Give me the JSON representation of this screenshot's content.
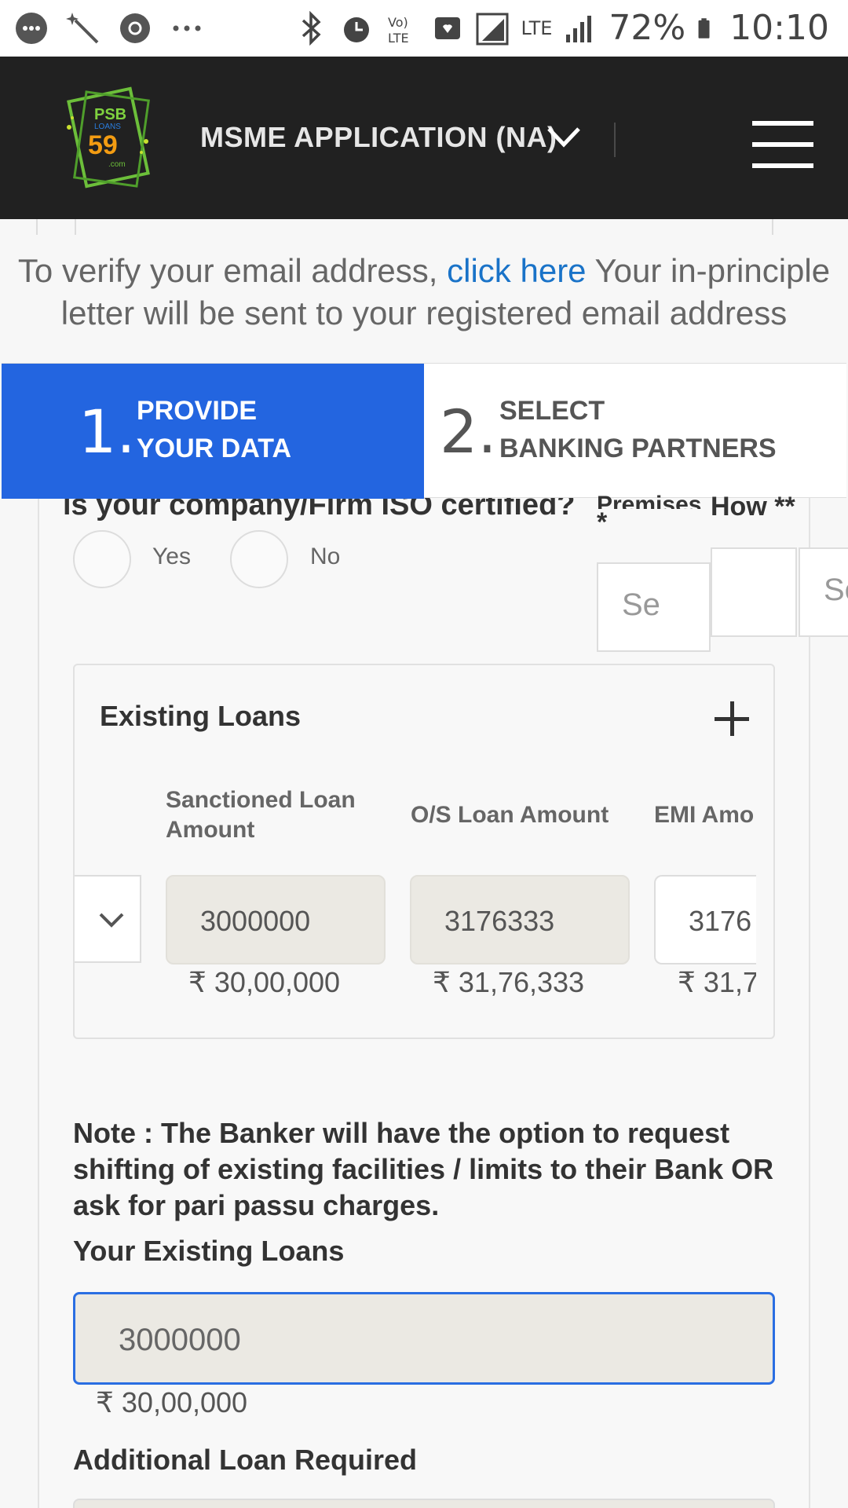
{
  "status_bar": {
    "battery": "72%",
    "time": "10:10",
    "network": "LTE",
    "icons": [
      "message-icon",
      "wand-icon",
      "settings-icon",
      "more-icon",
      "bluetooth-icon",
      "alarm-icon",
      "volte-icon",
      "notification-icon",
      "signal-icon",
      "battery-icon"
    ]
  },
  "header": {
    "logo_text": "PSB LOANS 59 .com",
    "title": "MSME APPLICATION (NA)"
  },
  "verify_banner": {
    "before": "To verify your email address, ",
    "link": "click here",
    "after": " Your in-principle letter will be sent to your registered email address"
  },
  "stepper": {
    "steps": [
      {
        "num": "1.",
        "line1": "PROVIDE",
        "line2": "YOUR DATA",
        "active": true
      },
      {
        "num": "2.",
        "line1": "SELECT",
        "line2": "BANKING PARTNERS",
        "active": false
      }
    ]
  },
  "form": {
    "clipped_question": "is your company/Firm ISO certified?",
    "radio_yes": "Yes",
    "radio_no": "No",
    "premises_label": "Premises",
    "premises_required": "*",
    "how_label": "How **",
    "select_placeholder_1": "Se",
    "select_placeholder_2": "Se"
  },
  "existing_loans": {
    "title": "Existing Loans",
    "columns": [
      "Sanctioned Loan Amount",
      "O/S Loan Amount",
      "EMI Amo"
    ],
    "row": {
      "sanctioned": "3000000",
      "sanctioned_fmt": "₹ 30,00,000",
      "outstanding": "3176333",
      "outstanding_fmt": "₹ 31,76,333",
      "emi": "3176",
      "emi_fmt": "₹ 31,7"
    }
  },
  "note": "Note : The Banker will have the option to request shifting of existing facilities / limits to their Bank OR ask for pari passu charges.",
  "your_existing_loans": {
    "label": "Your Existing Loans",
    "value": "3000000",
    "value_fmt": "₹ 30,00,000"
  },
  "additional_loan": {
    "label": "Additional Loan Required"
  },
  "colors": {
    "appbar": "#212121",
    "step_active": "#2365e0",
    "link": "#1a73c8",
    "input_focus": "#2a6ee2"
  }
}
